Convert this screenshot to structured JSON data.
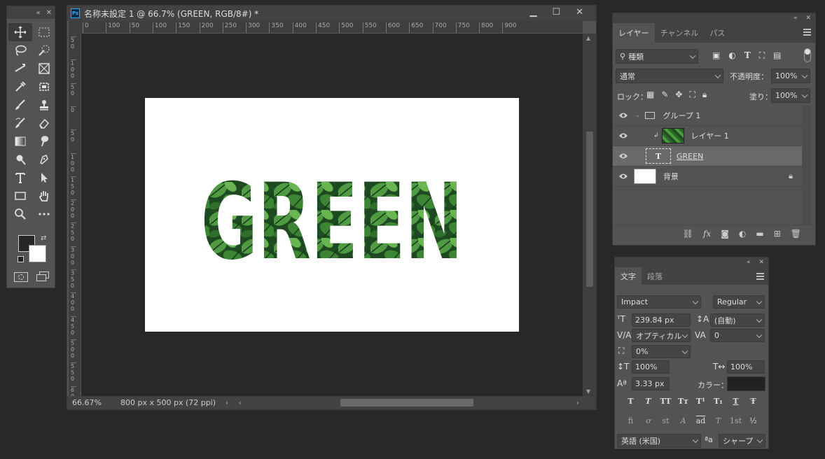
{
  "document": {
    "title": "名称未設定 1 @ 66.7% (GREEN, RGB/8#) *",
    "app_icon": "Ps",
    "zoom": "66.67%",
    "doc_size": "800 px x 500 px (72 ppi)",
    "ruler_h": [
      "0",
      "100",
      "50",
      "100",
      "150",
      "200",
      "250",
      "300",
      "350",
      "400",
      "450",
      "500",
      "550",
      "600",
      "650",
      "700",
      "750",
      "800",
      "900"
    ],
    "ruler_v": [
      "5 0",
      "1 0 0",
      "5 0",
      "0",
      "5 0",
      "1 0 0",
      "1 5 0",
      "2 0 0",
      "2 5 0",
      "3 0 0",
      "3 5 0",
      "4 0 0",
      "4 5 0",
      "5 0 0",
      "5 5 0",
      "6 0 0"
    ],
    "canvas_text": "GREEN",
    "canvas_text_colors": [
      "#1f4d25",
      "#3d8a3a",
      "#5da84a",
      "#2a5e2a",
      "#163a1b"
    ]
  },
  "layers_panel": {
    "tabs": [
      "レイヤー",
      "チャンネル",
      "パス"
    ],
    "filter_kind": "種類",
    "blend_mode": "通常",
    "opacity_label": "不透明度：",
    "opacity_value": "100%",
    "lock_label": "ロック：",
    "fill_label": "塗り：",
    "fill_value": "100%",
    "layers": [
      {
        "name": "グループ 1",
        "kind": "group"
      },
      {
        "name": "レイヤー 1",
        "kind": "image"
      },
      {
        "name": "GREEN",
        "kind": "text",
        "thumb_text": "T"
      },
      {
        "name": "背景",
        "kind": "background"
      }
    ]
  },
  "character_panel": {
    "tabs": [
      "文字",
      "段落"
    ],
    "font_family": "Impact",
    "font_style": "Regular",
    "font_size": "239.84 px",
    "leading": "(自動)",
    "kerning": "オプティカル",
    "tracking": "0",
    "tsume": "0%",
    "vertical_scale": "100%",
    "horizontal_scale": "100%",
    "baseline_shift": "3.33 px",
    "color_label": "カラー：",
    "color_value": "#222222",
    "style_buttons": [
      "T",
      "T",
      "TT",
      "Tт",
      "T¹",
      "T₁",
      "T",
      "Ŧ"
    ],
    "opentype_buttons": [
      "fi",
      "ơ",
      "st",
      "A",
      "ad",
      "T",
      "1st",
      "½"
    ],
    "language": "英語 (米国)",
    "aa_label": "ªa",
    "antialias": "シャープ"
  }
}
